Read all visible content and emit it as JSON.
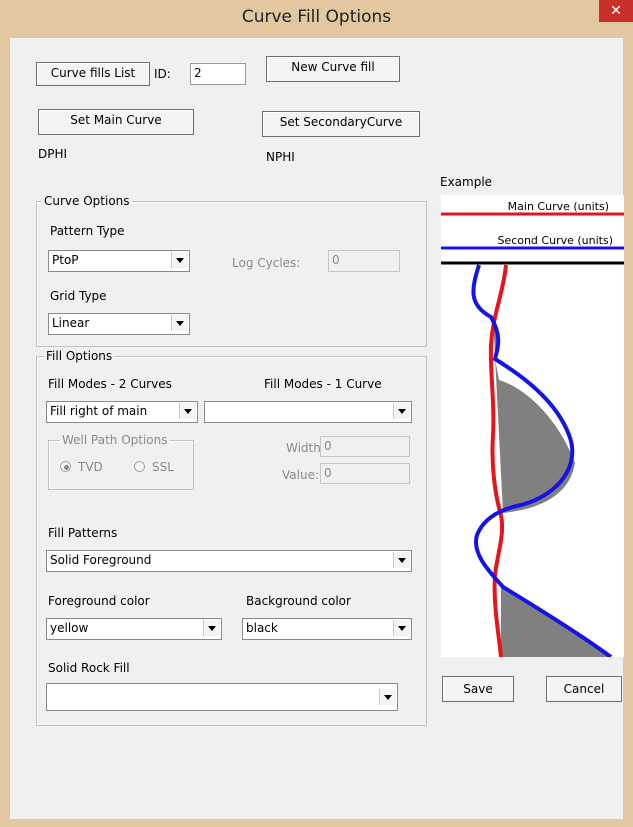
{
  "window": {
    "title": "Curve Fill Options",
    "close_glyph": "✕"
  },
  "top": {
    "curve_fills_list_label": "Curve fills List",
    "id_label": "ID:",
    "id_value": "2",
    "new_curve_fill_label": "New Curve fill",
    "set_main_curve_label": "Set Main Curve",
    "set_secondary_curve_label": "Set SecondaryCurve",
    "main_curve_name": "DPHI",
    "secondary_curve_name": "NPHI"
  },
  "curve_options": {
    "group_label": "Curve Options",
    "pattern_type_label": "Pattern Type",
    "pattern_type_value": "PtoP",
    "log_cycles_label": "Log Cycles:",
    "log_cycles_value": "0",
    "grid_type_label": "Grid Type",
    "grid_type_value": "Linear"
  },
  "fill_options": {
    "group_label": "Fill Options",
    "fill_modes_2_label": "Fill Modes - 2 Curves",
    "fill_modes_1_label": "Fill Modes - 1 Curve",
    "fill_modes_2_value": "Fill right of main",
    "fill_modes_1_value": "",
    "well_path_label": "Well Path Options",
    "tvd_label": "TVD",
    "ssl_label": "SSL",
    "width_label": "Width:",
    "width_value": "0",
    "value_label": "Value:",
    "value_value": "0",
    "fill_patterns_label": "Fill Patterns",
    "fill_patterns_value": "Solid Foreground",
    "foreground_color_label": "Foreground color",
    "foreground_color_value": "yellow",
    "background_color_label": "Background color",
    "background_color_value": "black",
    "solid_rock_fill_label": "Solid Rock Fill",
    "solid_rock_fill_value": ""
  },
  "example": {
    "label": "Example",
    "main_curve_label": "Main Curve (units)",
    "second_curve_label": "Second Curve (units)",
    "colors": {
      "main": "#e8141c",
      "second": "#1414e6",
      "fill": "#808080",
      "separator": "#000000"
    }
  },
  "actions": {
    "save_label": "Save",
    "cancel_label": "Cancel"
  }
}
